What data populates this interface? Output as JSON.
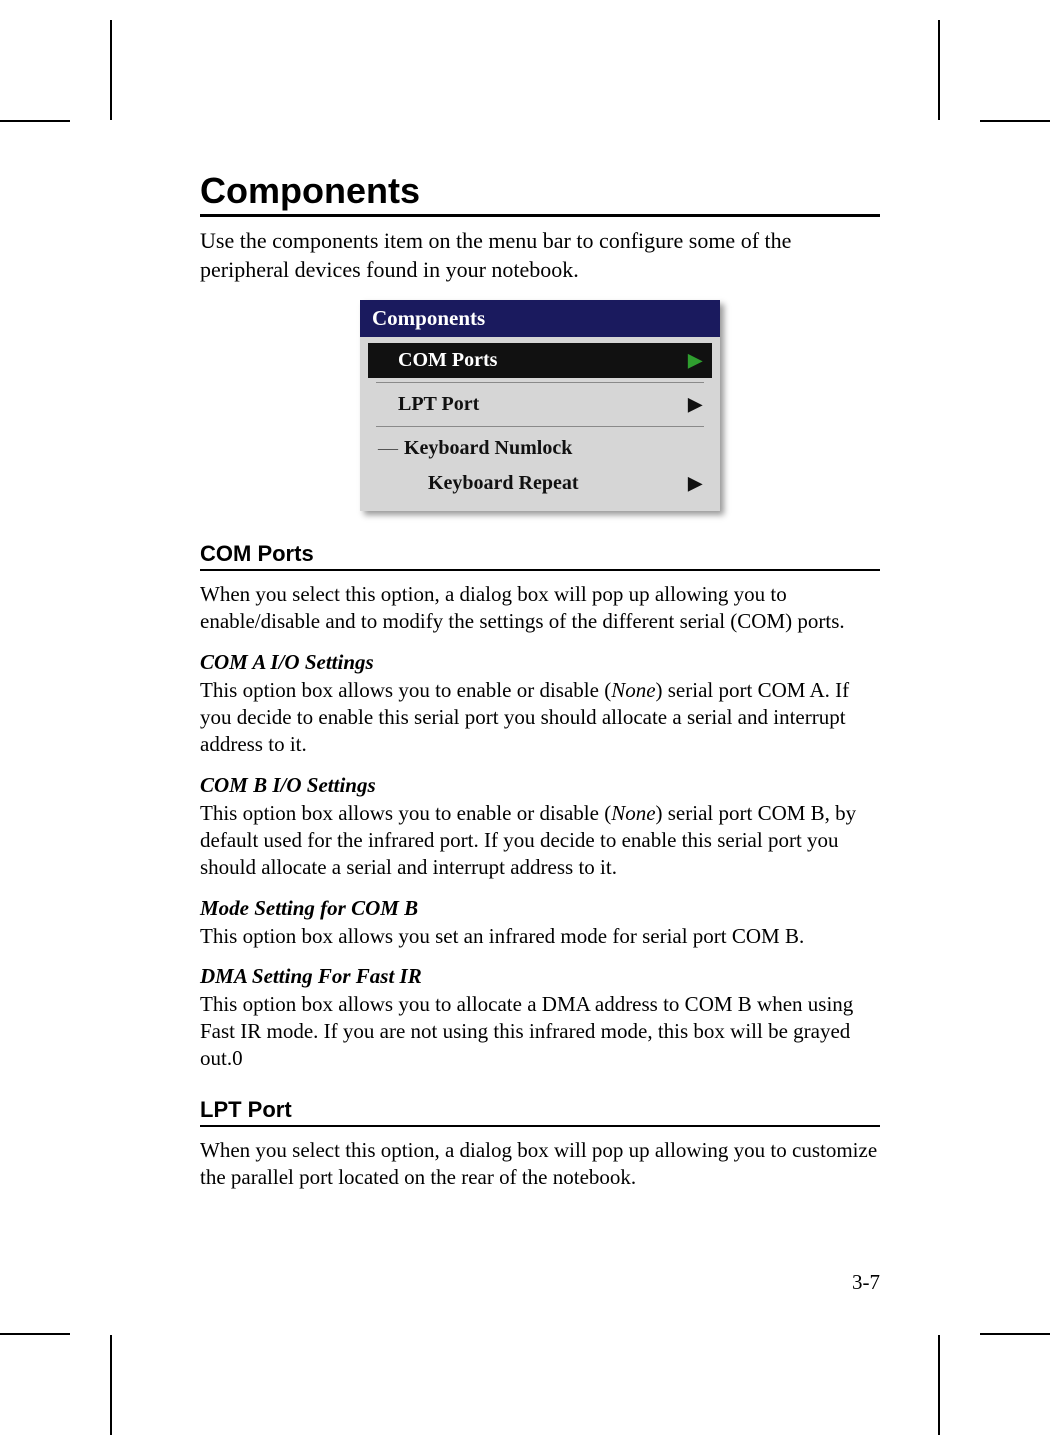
{
  "title": "Components",
  "intro": "Use the components item on the menu bar to configure some of the peripheral devices found in your notebook.",
  "menu": {
    "title": "Components",
    "items": {
      "com_ports": "COM Ports",
      "lpt_port": "LPT Port",
      "kbd_numlock_prefix": "—",
      "kbd_numlock": "Keyboard Numlock",
      "kbd_repeat": "Keyboard Repeat"
    }
  },
  "sections": {
    "com_ports": {
      "heading": "COM Ports",
      "intro": "When you select this option, a dialog box will pop up allowing you to enable/disable and to modify the settings of the different serial (COM) ports.",
      "sub": [
        {
          "h": "COM A I/O Settings",
          "p_before": "This option box allows you to enable or disable (",
          "p_italic": "None",
          "p_after": ") serial port COM A. If you decide to enable this serial port you should allocate a serial and interrupt address to it."
        },
        {
          "h": "COM B I/O Settings",
          "p_before": "This option box allows you to enable or disable (",
          "p_italic": "None",
          "p_after": ") serial port COM B, by default used for the infrared port. If you decide to enable this serial port you should allocate a serial and interrupt address to it."
        },
        {
          "h": "Mode Setting for COM B",
          "p_before": "This option box allows you set an infrared mode for serial port COM B.",
          "p_italic": "",
          "p_after": ""
        },
        {
          "h": "DMA Setting For Fast IR",
          "p_before": "This option box allows you to allocate a DMA address to COM B when using Fast IR mode. If you are not using this infrared mode, this box will be grayed out.0",
          "p_italic": "",
          "p_after": ""
        }
      ]
    },
    "lpt_port": {
      "heading": "LPT Port",
      "intro": "When you select this option, a dialog box will pop up allowing you to customize the parallel port located on the rear of the notebook."
    }
  },
  "page_number": "3-7"
}
